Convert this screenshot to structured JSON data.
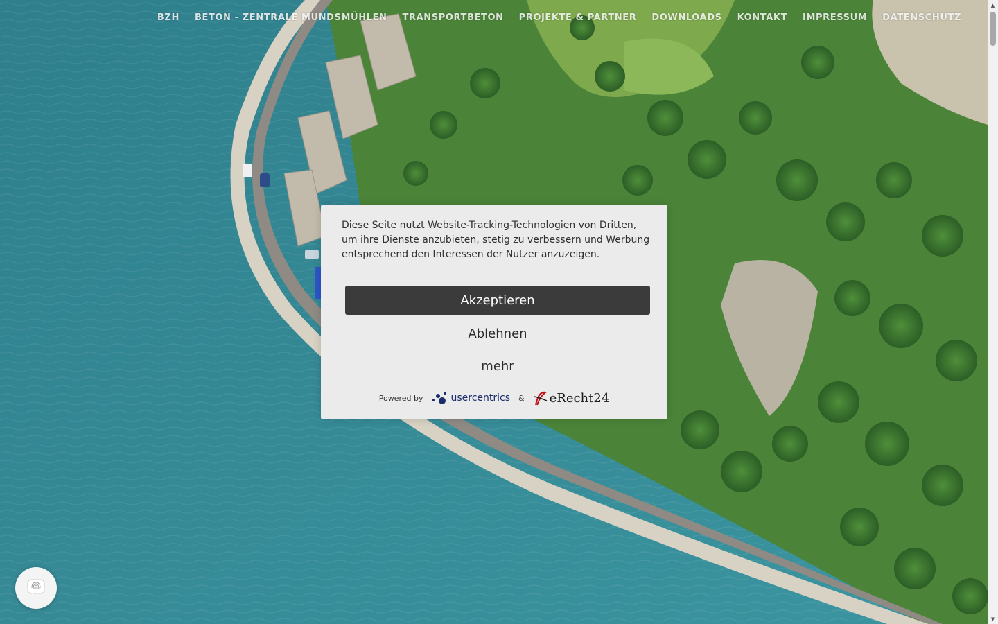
{
  "nav": {
    "items": [
      {
        "label": "BZH"
      },
      {
        "label": "BETON - ZENTRALE MUNDSMÜHLEN"
      },
      {
        "label": "TRANSPORTBETON"
      },
      {
        "label": "PROJEKTE & PARTNER"
      },
      {
        "label": "DOWNLOADS"
      },
      {
        "label": "KONTAKT"
      },
      {
        "label": "IMPRESSUM"
      },
      {
        "label": "DATENSCHUTZ"
      }
    ]
  },
  "consent": {
    "text": "Diese Seite nutzt Website-Tracking-Technologien von Dritten, um ihre Dienste anzubieten, stetig zu verbessern und Werbung entsprechend den Interessen der Nutzer anzuzeigen.",
    "accept_label": "Akzeptieren",
    "decline_label": "Ablehnen",
    "more_label": "mehr",
    "powered_by": "Powered by",
    "usercentrics": "usercentrics",
    "ampersand": "&",
    "erecht24": "eRecht24"
  },
  "colors": {
    "accept_bg": "#3b3b3b",
    "modal_bg": "#ebebeb",
    "water": "#3a8a95",
    "forest": "#3f7a32"
  },
  "icons": {
    "privacy_fab": "fingerprint-icon"
  }
}
